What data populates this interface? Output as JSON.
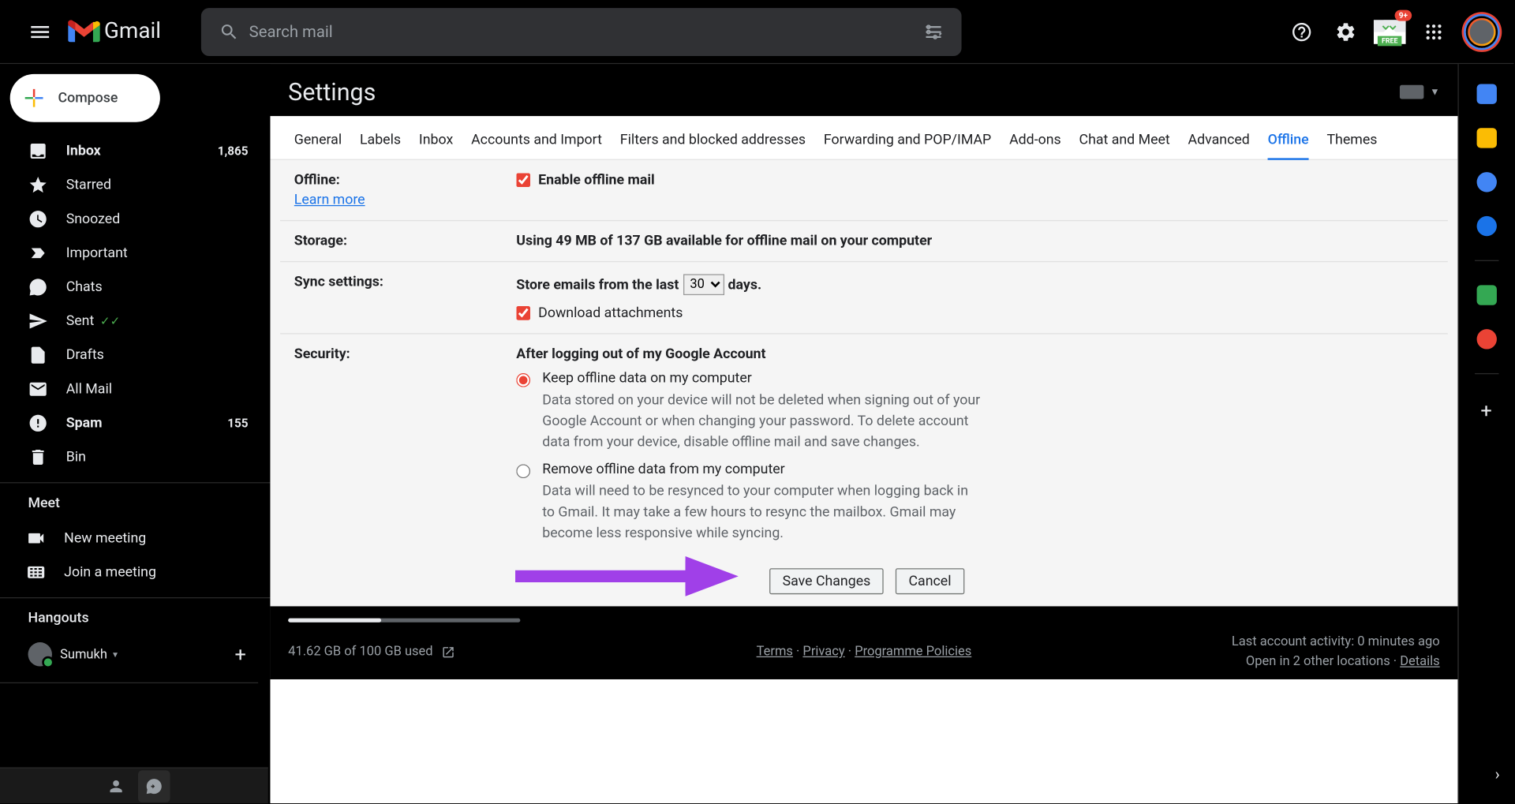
{
  "header": {
    "app_name": "Gmail",
    "search_placeholder": "Search mail",
    "notification_count": "9+",
    "free_label": "FREE"
  },
  "sidebar": {
    "compose": "Compose",
    "items": [
      {
        "label": "Inbox",
        "count": "1,865",
        "bold": true,
        "icon": "inbox"
      },
      {
        "label": "Starred",
        "count": "",
        "bold": false,
        "icon": "star"
      },
      {
        "label": "Snoozed",
        "count": "",
        "bold": false,
        "icon": "clock"
      },
      {
        "label": "Important",
        "count": "",
        "bold": false,
        "icon": "important"
      },
      {
        "label": "Chats",
        "count": "",
        "bold": false,
        "icon": "chat"
      },
      {
        "label": "Sent",
        "count": "",
        "bold": false,
        "icon": "sent",
        "checks": true
      },
      {
        "label": "Drafts",
        "count": "",
        "bold": false,
        "icon": "draft"
      },
      {
        "label": "All Mail",
        "count": "",
        "bold": false,
        "icon": "mail"
      },
      {
        "label": "Spam",
        "count": "155",
        "bold": true,
        "icon": "spam"
      },
      {
        "label": "Bin",
        "count": "",
        "bold": false,
        "icon": "trash"
      }
    ],
    "meet_title": "Meet",
    "meet_items": [
      {
        "label": "New meeting",
        "icon": "video"
      },
      {
        "label": "Join a meeting",
        "icon": "keyboard"
      }
    ],
    "hangouts_title": "Hangouts",
    "hangouts_user": "Sumukh"
  },
  "settings": {
    "title": "Settings",
    "tabs": [
      "General",
      "Labels",
      "Inbox",
      "Accounts and Import",
      "Filters and blocked addresses",
      "Forwarding and POP/IMAP",
      "Add-ons",
      "Chat and Meet",
      "Advanced",
      "Offline",
      "Themes"
    ],
    "active_tab": "Offline",
    "offline": {
      "label": "Offline:",
      "learn_more": "Learn more",
      "enable": "Enable offline mail"
    },
    "storage": {
      "label": "Storage:",
      "value": "Using 49 MB of 137 GB available for offline mail on your computer"
    },
    "sync": {
      "label": "Sync settings:",
      "store_prefix": "Store emails from the last",
      "store_value": "30",
      "store_suffix": "days.",
      "download_attachments": "Download attachments"
    },
    "security": {
      "label": "Security:",
      "heading": "After logging out of my Google Account",
      "option1_title": "Keep offline data on my computer",
      "option1_desc": "Data stored on your device will not be deleted when signing out of your Google Account or when changing your password. To delete account data from your device, disable offline mail and save changes.",
      "option2_title": "Remove offline data from my computer",
      "option2_desc": "Data will need to be resynced to your computer when logging back in to Gmail. It may take a few hours to resync the mailbox. Gmail may become less responsive while syncing."
    },
    "save_button": "Save Changes",
    "cancel_button": "Cancel"
  },
  "footer": {
    "storage_used": "41.62 GB of 100 GB used",
    "terms": "Terms",
    "privacy": "Privacy",
    "policies": "Programme Policies",
    "activity": "Last account activity: 0 minutes ago",
    "locations": "Open in 2 other locations",
    "details": "Details"
  }
}
